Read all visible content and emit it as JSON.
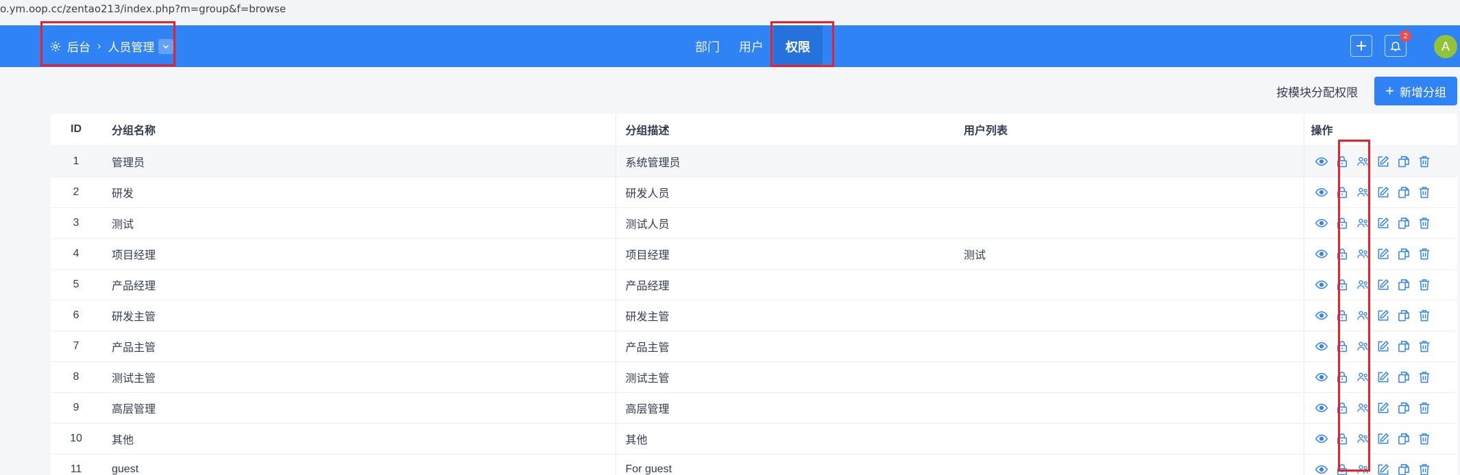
{
  "browser": {
    "url": "o.ym.oop.cc/zentao213/index.php?m=group&f=browse"
  },
  "header": {
    "breadcrumb": {
      "root": "后台",
      "current": "人员管理"
    },
    "tabs": [
      {
        "label": "部门",
        "active": false
      },
      {
        "label": "用户",
        "active": false
      },
      {
        "label": "权限",
        "active": true
      }
    ],
    "notification_count": "2",
    "avatar_letter": "A"
  },
  "toolbar": {
    "assign_by_module": "按模块分配权限",
    "add_group": "新增分组"
  },
  "table": {
    "columns": {
      "id": "ID",
      "name": "分组名称",
      "desc": "分组描述",
      "users": "用户列表",
      "ops": "操作"
    },
    "rows": [
      {
        "id": "1",
        "name": "管理员",
        "desc": "系统管理员",
        "users": ""
      },
      {
        "id": "2",
        "name": "研发",
        "desc": "研发人员",
        "users": ""
      },
      {
        "id": "3",
        "name": "测试",
        "desc": "测试人员",
        "users": ""
      },
      {
        "id": "4",
        "name": "项目经理",
        "desc": "项目经理",
        "users": "测试"
      },
      {
        "id": "5",
        "name": "产品经理",
        "desc": "产品经理",
        "users": ""
      },
      {
        "id": "6",
        "name": "研发主管",
        "desc": "研发主管",
        "users": ""
      },
      {
        "id": "7",
        "name": "产品主管",
        "desc": "产品主管",
        "users": ""
      },
      {
        "id": "8",
        "name": "测试主管",
        "desc": "测试主管",
        "users": ""
      },
      {
        "id": "9",
        "name": "高层管理",
        "desc": "高层管理",
        "users": ""
      },
      {
        "id": "10",
        "name": "其他",
        "desc": "其他",
        "users": ""
      },
      {
        "id": "11",
        "name": "guest",
        "desc": "For guest",
        "users": ""
      }
    ],
    "row_actions": [
      "view-icon",
      "lock-icon",
      "users-icon",
      "edit-icon",
      "copy-icon",
      "trash-icon"
    ]
  },
  "colors": {
    "primary": "#2f83f5",
    "active_tab": "#2672dd",
    "highlight_box": "#e8202a",
    "avatar": "#90c23a"
  }
}
